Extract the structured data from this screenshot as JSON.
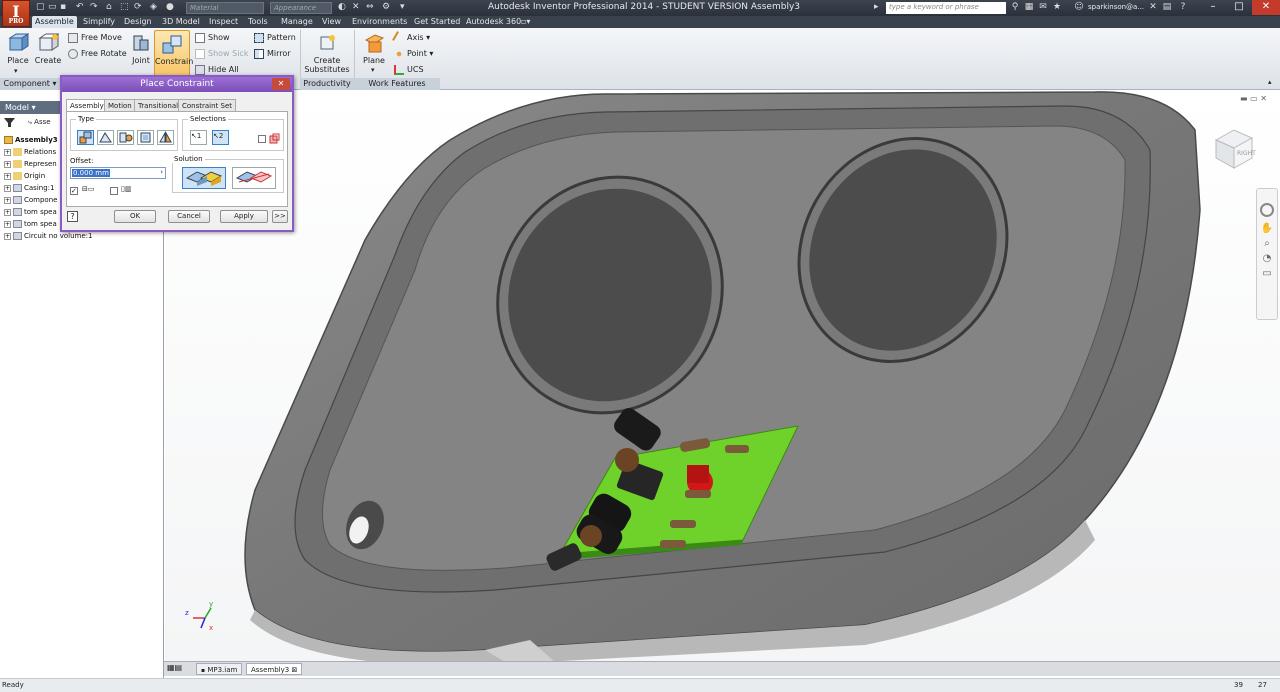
{
  "app": {
    "logo_letter": "I",
    "logo_sub": "PRO",
    "title": "Autodesk Inventor Professional 2014 - STUDENT VERSION    Assembly3",
    "material_placeholder": "Material",
    "appearance_placeholder": "Appearance",
    "search_placeholder": "type a keyword or phrase",
    "user": "sparkinson@a..."
  },
  "ribbon_tabs": [
    "Assemble",
    "Simplify",
    "Design",
    "3D Model",
    "Inspect",
    "Tools",
    "Manage",
    "View",
    "Environments",
    "Get Started",
    "Autodesk 360"
  ],
  "ribbon": {
    "place": "Place",
    "create": "Create",
    "free_move": "Free Move",
    "free_rotate": "Free Rotate",
    "joint": "Joint",
    "constrain": "Constrain",
    "show": "Show",
    "show_sick": "Show Sick",
    "hide_all": "Hide All",
    "pattern": "Pattern",
    "mirror": "Mirror",
    "create_substitutes_1": "Create",
    "create_substitutes_2": "Substitutes",
    "plane": "Plane",
    "axis": "Axis",
    "point": "Point",
    "ucs": "UCS",
    "panel_component": "Component",
    "panel_productivity": "Productivity",
    "panel_work_features": "Work Features"
  },
  "model_panel": {
    "header": "Model",
    "search_stub": "Asse",
    "tree": [
      "Assembly3",
      "Relations",
      "Represen",
      "Origin",
      "Casing:1",
      "Compone",
      "tom spea",
      "tom spea",
      "Circuit no volume:1"
    ]
  },
  "dialog": {
    "title": "Place Constraint",
    "tabs": [
      "Assembly",
      "Motion",
      "Transitional",
      "Constraint Set"
    ],
    "type_label": "Type",
    "selections_label": "Selections",
    "sel1": "1",
    "sel2": "2",
    "offset_label": "Offset:",
    "offset_value": "0.000 mm",
    "solution_label": "Solution",
    "ok": "OK",
    "cancel": "Cancel",
    "apply": "Apply",
    "more": ">>"
  },
  "viewcube_label": "RIGHT",
  "doc_tabs": [
    "MP3.iam",
    "Assembly3"
  ],
  "status": {
    "left": "Ready",
    "num1": "39",
    "num2": "27"
  },
  "colors": {
    "dialog_border": "#8a5bc7",
    "ribbon_active": "#dfe4ea",
    "pcb_green": "#6ed22a"
  }
}
